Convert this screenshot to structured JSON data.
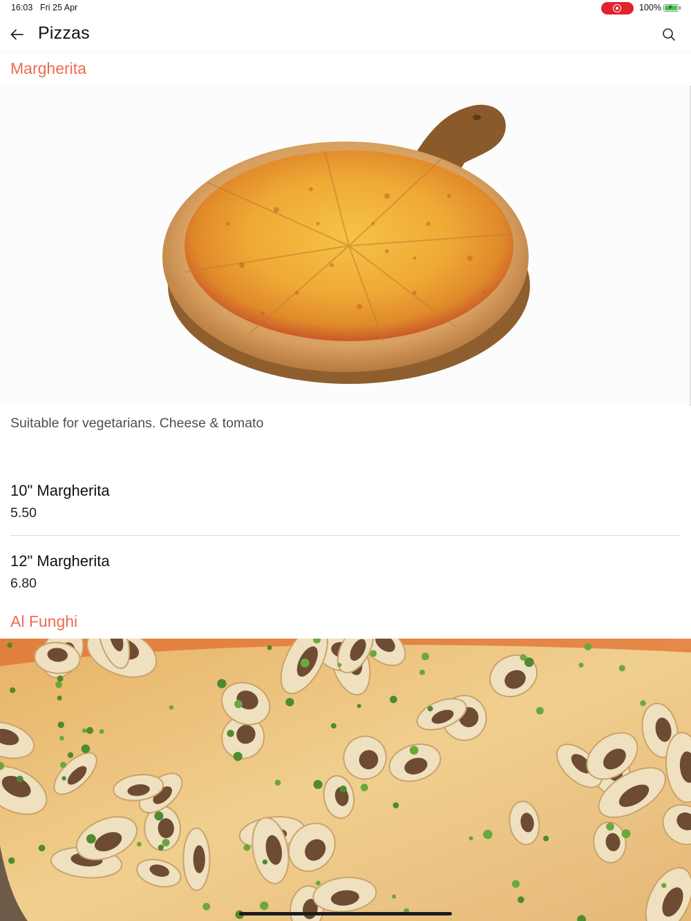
{
  "status_bar": {
    "time": "16:03",
    "date": "Fri 25 Apr",
    "battery_percent": "100%",
    "battery_level": 1.0,
    "recording_indicator_icon": "screen-recording-icon",
    "battery_icon": "battery-charging-icon"
  },
  "nav": {
    "title": "Pizzas",
    "back_icon": "arrow-left-icon",
    "search_icon": "search-icon"
  },
  "sections": [
    {
      "title": "Margherita",
      "image_icon": "margherita-pizza-image",
      "description": "Suitable for vegetarians. Cheese & tomato",
      "items": [
        {
          "name": "10\" Margherita",
          "price": "5.50"
        },
        {
          "name": "12\" Margherita",
          "price": "6.80"
        }
      ]
    },
    {
      "title": "Al Funghi",
      "image_icon": "mushroom-pizza-image"
    }
  ],
  "colors": {
    "accent": "#ef6a50",
    "recording_pill": "#e0242f",
    "battery_fill": "#3ec94a",
    "text_primary": "#111111",
    "text_secondary": "#4d4d4d"
  }
}
